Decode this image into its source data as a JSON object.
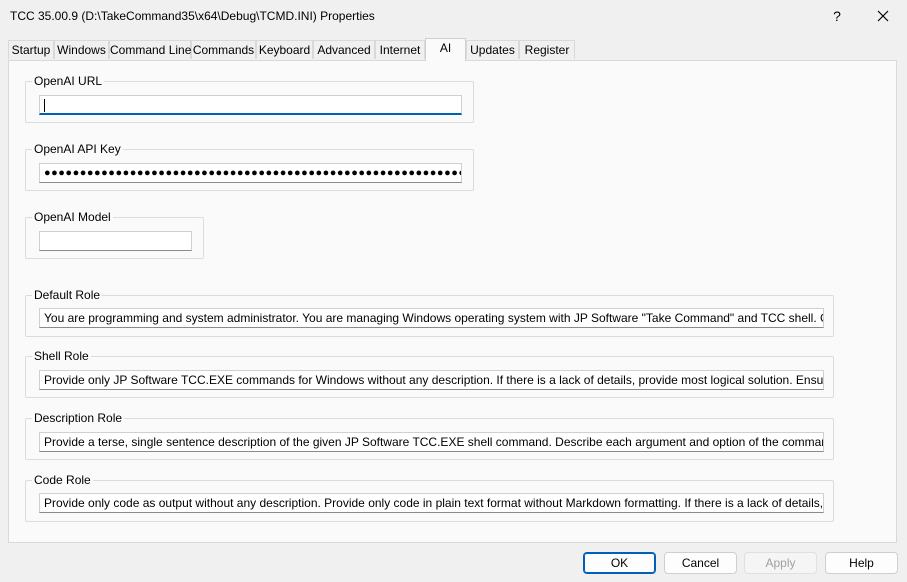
{
  "window": {
    "title": "TCC  35.00.9  (D:\\TakeCommand35\\x64\\Debug\\TCMD.INI)  Properties",
    "help_label": "?"
  },
  "tabs": [
    {
      "label": "Startup"
    },
    {
      "label": "Windows"
    },
    {
      "label": "Command Line"
    },
    {
      "label": "Commands"
    },
    {
      "label": "Keyboard"
    },
    {
      "label": "Advanced"
    },
    {
      "label": "Internet"
    },
    {
      "label": "AI"
    },
    {
      "label": "Updates"
    },
    {
      "label": "Register"
    }
  ],
  "active_tab": "AI",
  "fields": {
    "openai_url": {
      "label": "OpenAI URL",
      "value": ""
    },
    "openai_api_key": {
      "label": "OpenAI API Key",
      "value": "●●●●●●●●●●●●●●●●●●●●●●●●●●●●●●●●●●●●●●●●●●●●●●●●●●●●●●●●●●●"
    },
    "openai_model": {
      "label": "OpenAI Model",
      "value": ""
    },
    "default_role": {
      "label": "Default Role",
      "value": "You are programming and system administrator. You are managing Windows operating system with JP Software \"Take Command\" and TCC shell. Give advice abou"
    },
    "shell_role": {
      "label": "Shell Role",
      "value": "Provide only JP Software TCC.EXE commands for Windows without any description. If there is a lack of details, provide most logical solution. Ensure the output is a"
    },
    "description_role": {
      "label": "Description Role",
      "value": "Provide a terse, single sentence description of the given JP Software TCC.EXE shell command. Describe each argument and option of the command. Provide short"
    },
    "code_role": {
      "label": "Code Role",
      "value": "Provide only code as output without any description. Provide only code in plain text format without Markdown formatting. If there is a lack of details, provide most"
    }
  },
  "buttons": {
    "ok": "OK",
    "cancel": "Cancel",
    "apply": "Apply",
    "help": "Help"
  }
}
